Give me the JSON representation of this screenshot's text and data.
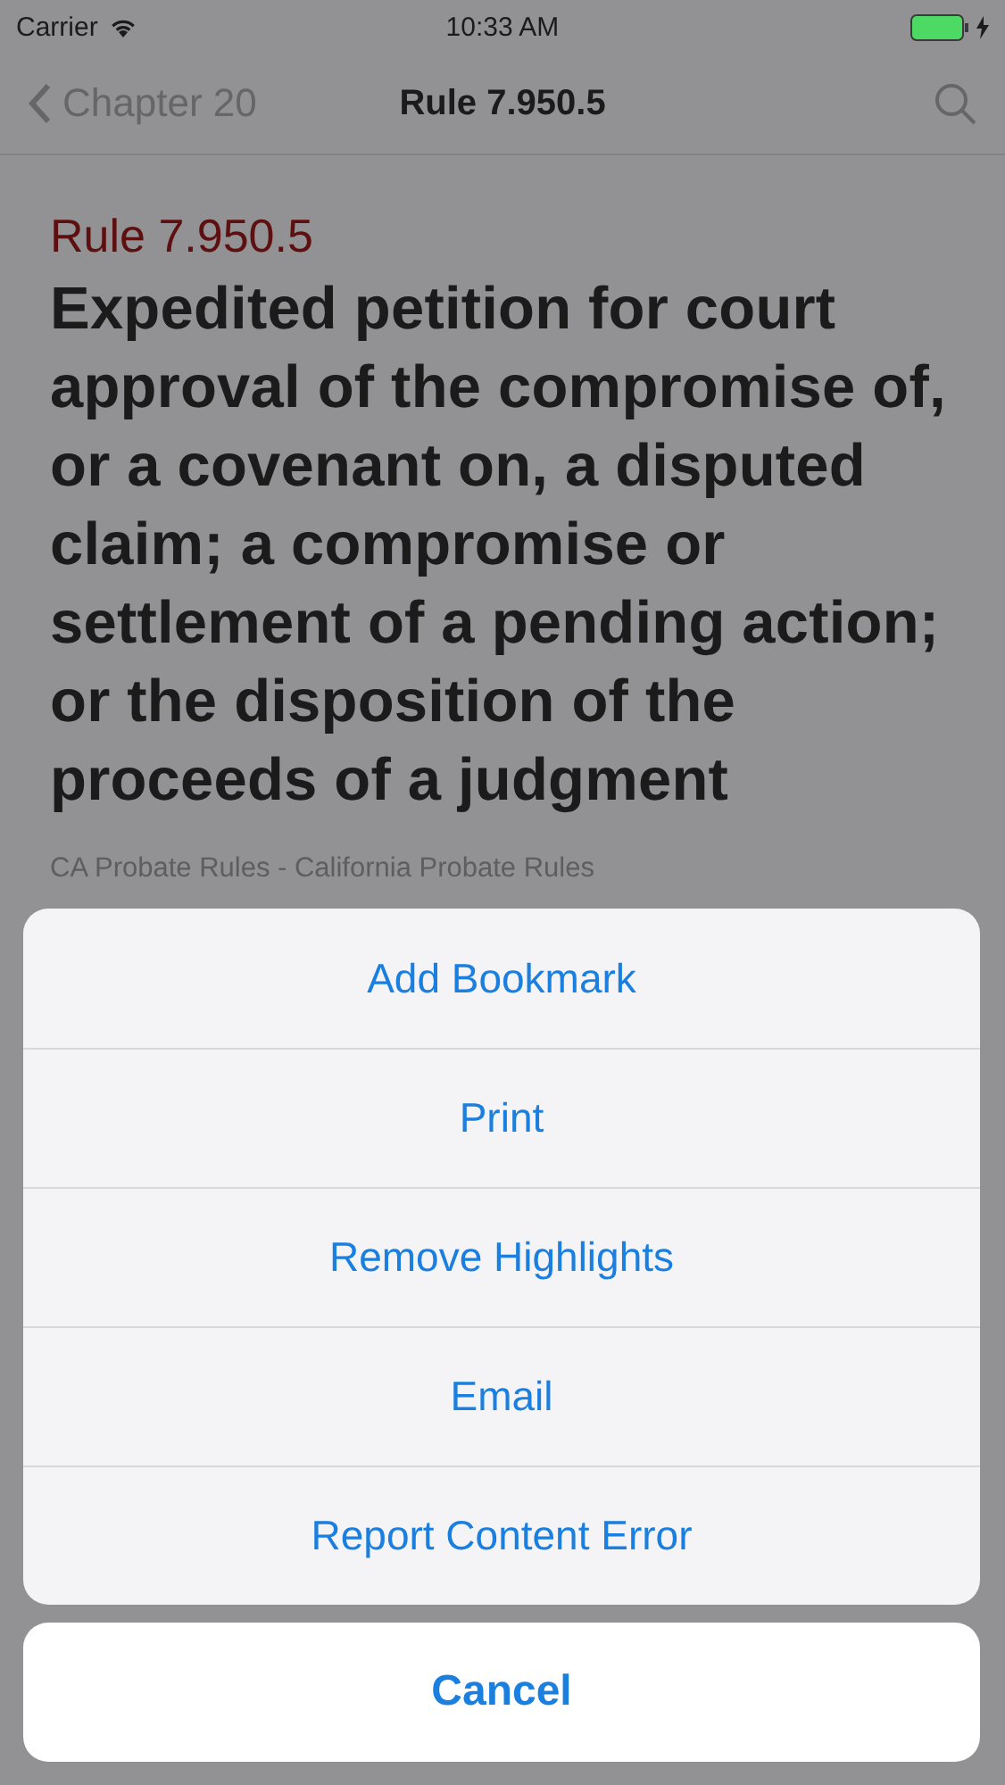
{
  "status_bar": {
    "carrier": "Carrier",
    "time": "10:33 AM"
  },
  "nav": {
    "back": "Chapter 20",
    "title": "Rule 7.950.5"
  },
  "rule": {
    "number": "Rule 7.950.5",
    "heading": "Expedited petition for court approval of the compromise of, or a covenant on, a disputed claim; a compromise or settlement of a pending action; or the disposition of the proceeds of a judgment",
    "source": "CA Probate Rules - California Probate Rules"
  },
  "action_sheet": {
    "actions": [
      "Add Bookmark",
      "Print",
      "Remove Highlights",
      "Email",
      "Report Content Error"
    ],
    "cancel": "Cancel"
  }
}
